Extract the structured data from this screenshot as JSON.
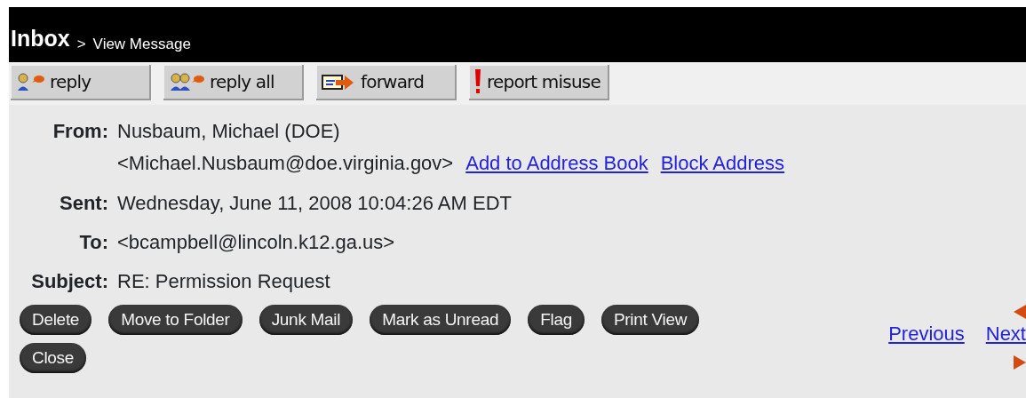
{
  "breadcrumb": {
    "current": "Inbox",
    "separator": ">",
    "page": "View Message"
  },
  "toolbar": [
    {
      "label": "reply",
      "kind": "reply"
    },
    {
      "label": "reply all",
      "kind": "reply_all"
    },
    {
      "label": "forward",
      "kind": "forward"
    },
    {
      "label": "report misuse",
      "kind": "report"
    }
  ],
  "header": [
    {
      "label": "From:",
      "value": "Nusbaum, Michael (DOE)<Michael.Nusbaum@doe.virginia.gov>",
      "links": [
        "Add to Address Book",
        "Block Address"
      ]
    },
    {
      "label": "Sent:",
      "value": "Wednesday, June 11, 2008 10:04:26 AM EDT"
    },
    {
      "label": "To:",
      "value": "<bcampbell@lincoln.k12.ga.us>"
    },
    {
      "label": "Subject:",
      "value": "RE: Permission Request"
    }
  ],
  "actions": [
    "Delete",
    "Move to Folder",
    "Junk Mail",
    "Mark as Unread",
    "Flag",
    "Print View",
    "Close"
  ],
  "pager": {
    "previous": "Previous",
    "next": "Next"
  }
}
